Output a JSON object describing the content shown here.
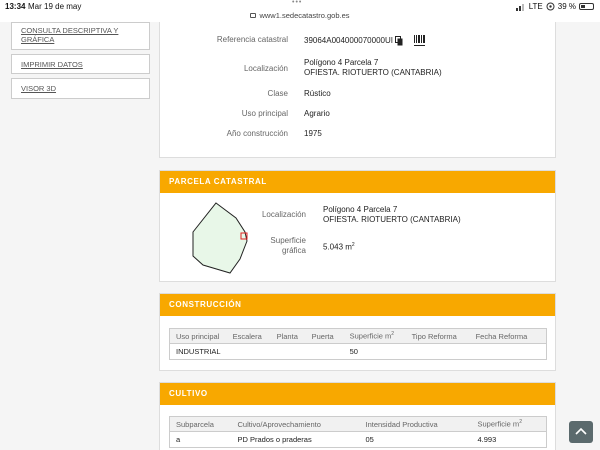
{
  "status_bar": {
    "time": "13:34",
    "date": "Mar 19 de may",
    "url": "www1.sedecatastro.gob.es",
    "network": "LTE",
    "battery": "39 %",
    "battery_level": 0.39
  },
  "sidebar": {
    "items": [
      {
        "label": "CONSULTA DESCRIPTIVA Y GRÁFICA"
      },
      {
        "label": "IMPRIMIR DATOS"
      },
      {
        "label": "VISOR 3D"
      }
    ]
  },
  "inmueble": {
    "rows": [
      {
        "label": "Referencia catastral",
        "value": "39064A004000070000UI"
      },
      {
        "label": "Localización",
        "value_line1": "Polígono 4 Parcela 7",
        "value_line2": "OFIESTA. RIOTUERTO (CANTABRIA)"
      },
      {
        "label": "Clase",
        "value": "Rústico"
      },
      {
        "label": "Uso principal",
        "value": "Agrario"
      },
      {
        "label": "Año construcción",
        "value": "1975"
      }
    ]
  },
  "parcela": {
    "title": "PARCELA CATASTRAL",
    "localizacion_label": "Localización",
    "localizacion_line1": "Polígono 4 Parcela 7",
    "localizacion_line2": "OFIESTA. RIOTUERTO (CANTABRIA)",
    "superficie_label_line1": "Superficie",
    "superficie_label_line2": "gráfica",
    "superficie_value": "5.043 m",
    "superficie_unit_sup": "2"
  },
  "construccion": {
    "title": "CONSTRUCCIÓN",
    "headers": [
      "Uso principal",
      "Escalera",
      "Planta",
      "Puerta",
      "Superficie m",
      "Tipo Reforma",
      "Fecha Reforma"
    ],
    "rows": [
      [
        "INDUSTRIAL",
        "",
        "",
        "",
        "50",
        "",
        ""
      ]
    ]
  },
  "cultivo": {
    "title": "CULTIVO",
    "headers": [
      "Subparcela",
      "Cultivo/Aprovechamiento",
      "Intensidad Productiva",
      "Superficie m"
    ],
    "rows": [
      [
        "a",
        "PD Prados o praderas",
        "05",
        "4.993"
      ]
    ]
  },
  "icons": {
    "copy": "copy-icon",
    "barcode": "barcode-icon",
    "scroll_top": "chevron-up-icon"
  }
}
